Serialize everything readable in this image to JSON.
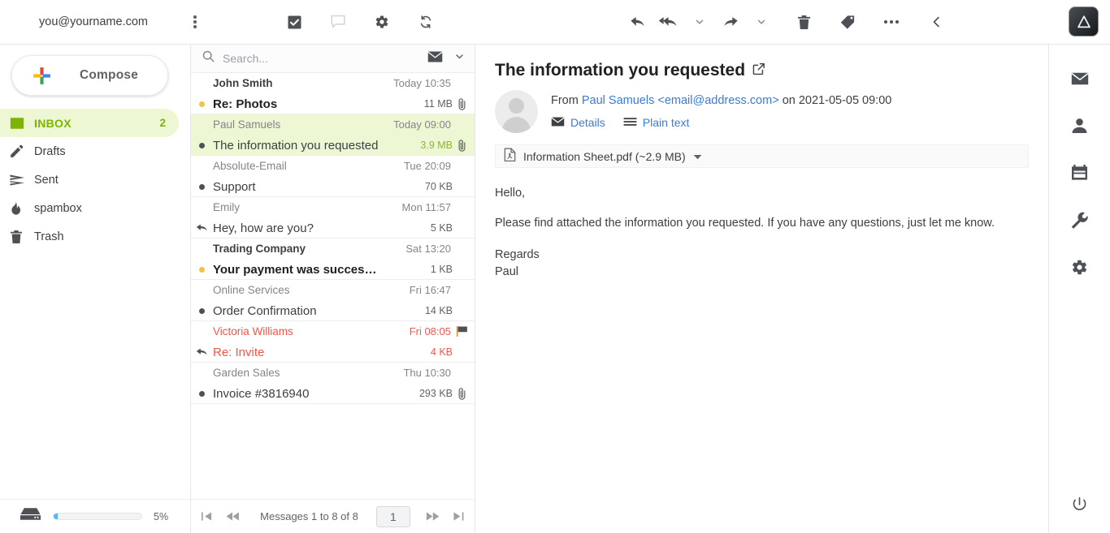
{
  "header": {
    "account_email": "you@yourname.com",
    "kebab_name": "account-options",
    "list_tools": [
      {
        "name": "select-all-checkbox",
        "icon": "checkbox-checked-icon",
        "label": "Select"
      },
      {
        "name": "threads-toggle",
        "icon": "chat-bubble-icon",
        "label": "Threads"
      },
      {
        "name": "list-settings",
        "icon": "gear-icon",
        "label": "Settings"
      },
      {
        "name": "refresh-button",
        "icon": "refresh-icon",
        "label": "Refresh"
      }
    ],
    "message_tools": [
      {
        "name": "reply-button",
        "icon": "reply-icon",
        "label": "Reply"
      },
      {
        "name": "reply-all-button",
        "icon": "reply-all-icon",
        "label": "Reply all"
      },
      {
        "name": "reply-all-dropdown",
        "icon": "chevron-down-icon",
        "label": "Reply options"
      },
      {
        "name": "forward-button",
        "icon": "forward-icon",
        "label": "Forward"
      },
      {
        "name": "forward-dropdown",
        "icon": "chevron-down-icon",
        "label": "Forward options"
      },
      {
        "name": "delete-button",
        "icon": "trash-icon",
        "label": "Delete"
      },
      {
        "name": "tag-button",
        "icon": "tag-icon",
        "label": "Tag"
      },
      {
        "name": "more-button",
        "icon": "ellipsis-icon",
        "label": "More"
      },
      {
        "name": "collapse-button",
        "icon": "chevron-left-icon",
        "label": "Back"
      }
    ],
    "logo_name": "app-logo"
  },
  "sidebar": {
    "compose_label": "Compose",
    "folders": [
      {
        "label": "INBOX",
        "count": "2",
        "icon": "inbox-icon",
        "active": true
      },
      {
        "label": "Drafts",
        "count": "",
        "icon": "pencil-icon",
        "active": false
      },
      {
        "label": "Sent",
        "count": "",
        "icon": "send-icon",
        "active": false
      },
      {
        "label": "spambox",
        "count": "",
        "icon": "fire-icon",
        "active": false
      },
      {
        "label": "Trash",
        "count": "",
        "icon": "trash-icon",
        "active": false
      }
    ],
    "quota": {
      "percent_label": "5%",
      "percent_value": 5,
      "icon": "disk-icon",
      "bar_color": "#4dbaf5"
    }
  },
  "list": {
    "search_placeholder": "Search...",
    "search_value": "",
    "search_scope_icon": "envelope-icon",
    "search_dropdown_icon": "chevron-down-icon",
    "messages": [
      {
        "sender": "John Smith",
        "subject": "Re: Photos",
        "date": "Today 10:35",
        "size": "11 MB",
        "unread": true,
        "status": "unread-dot",
        "attachment": true,
        "flagged": false,
        "selected": false
      },
      {
        "sender": "Paul Samuels",
        "subject": "The information you requested",
        "date": "Today 09:00",
        "size": "3.9 MB",
        "unread": false,
        "status": "read-dot",
        "attachment": true,
        "flagged": false,
        "selected": true
      },
      {
        "sender": "Absolute-Email",
        "subject": "Support",
        "date": "Tue 20:09",
        "size": "70 KB",
        "unread": false,
        "status": "read-dot",
        "attachment": false,
        "flagged": false,
        "selected": false
      },
      {
        "sender": "Emily",
        "subject": "Hey, how are you?",
        "date": "Mon 11:57",
        "size": "5 KB",
        "unread": false,
        "status": "replied-arrow",
        "attachment": false,
        "flagged": false,
        "selected": false
      },
      {
        "sender": "Trading Company",
        "subject": "Your payment was successful",
        "date": "Sat 13:20",
        "size": "1 KB",
        "unread": true,
        "status": "unread-dot",
        "attachment": false,
        "flagged": false,
        "selected": false
      },
      {
        "sender": "Online Services",
        "subject": "Order Confirmation",
        "date": "Fri 16:47",
        "size": "14 KB",
        "unread": false,
        "status": "read-dot",
        "attachment": false,
        "flagged": false,
        "selected": false
      },
      {
        "sender": "Victoria Williams",
        "subject": "Re: Invite",
        "date": "Fri 08:05",
        "size": "4 KB",
        "unread": false,
        "status": "replied-arrow",
        "attachment": false,
        "flagged": true,
        "selected": false
      },
      {
        "sender": "Garden Sales",
        "subject": "Invoice #3816940",
        "date": "Thu 10:30",
        "size": "293 KB",
        "unread": false,
        "status": "read-dot",
        "attachment": true,
        "flagged": false,
        "selected": false
      }
    ],
    "pager": {
      "first_icon": "first-page-icon",
      "prev_icon": "prev-page-icon",
      "status_text": "Messages 1 to 8 of 8",
      "page_value": "1",
      "next_icon": "next-page-icon",
      "last_icon": "last-page-icon"
    }
  },
  "message": {
    "subject": "The information you requested",
    "open_in_window_icon": "external-link-icon",
    "from_prefix": "From ",
    "from_name": "Paul Samuels <email@address.com>",
    "from_suffix": " on 2021-05-05 09:00",
    "details_label": "Details",
    "plaintext_label": "Plain text",
    "attachment": {
      "name": "Information Sheet.pdf (~2.9 MB)",
      "icon": "pdf-file-icon",
      "dropdown_icon": "caret-down-icon"
    },
    "body": {
      "greeting": "Hello,",
      "paragraph": "Please find attached the information you requested. If you have any questions, just let me know.",
      "signoff": "Regards",
      "signature": "Paul"
    }
  },
  "rail": {
    "items": [
      {
        "name": "rail-mail",
        "icon": "envelope-icon",
        "label": "Mail"
      },
      {
        "name": "rail-contacts",
        "icon": "person-icon",
        "label": "Contacts"
      },
      {
        "name": "rail-calendar",
        "icon": "calendar-icon",
        "label": "Calendar"
      },
      {
        "name": "rail-tools",
        "icon": "wrench-icon",
        "label": "Tools"
      },
      {
        "name": "rail-settings",
        "icon": "gear-icon",
        "label": "Settings"
      }
    ],
    "logout": {
      "name": "rail-logout",
      "icon": "power-icon",
      "label": "Logout"
    }
  },
  "colors": {
    "accent_green": "#7cb305",
    "selected_row": "#eef7d4",
    "link_blue": "#3a7bd5",
    "flag_red": "#f4574a",
    "unread_dot": "#f5c344",
    "quota_blue": "#4dbaf5"
  }
}
